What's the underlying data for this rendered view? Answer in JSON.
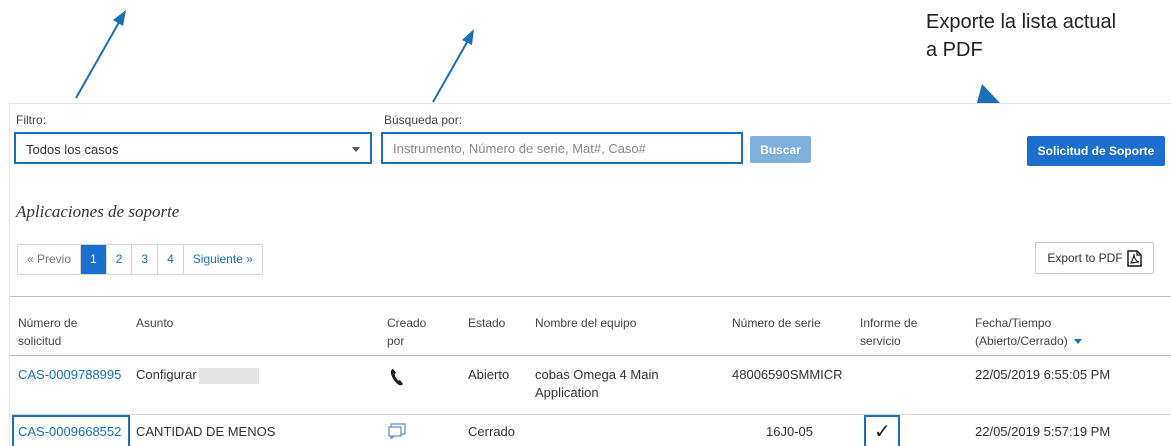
{
  "callout": {
    "line1": "Exporte la lista actual",
    "line2": "a PDF"
  },
  "filter": {
    "label": "Filtro:",
    "selected": "Todos los casos"
  },
  "search": {
    "label": "Búsqueda por:",
    "placeholder": "Instrumento, Número de serie, Mat#, Caso#",
    "value": "",
    "button_label": "Buscar"
  },
  "toolbar": {
    "support_button": "Solicitud de Soporte",
    "export_button": "Export to PDF"
  },
  "section": {
    "title": "Aplicaciones de soporte"
  },
  "pagination": {
    "prev": "« Previo",
    "pages": [
      "1",
      "2",
      "3",
      "4"
    ],
    "current": "1",
    "next": "Siguiente »"
  },
  "table": {
    "columns": {
      "case_number": [
        "Número de",
        "solicitud"
      ],
      "subject": "Asunto",
      "created_by": [
        "Creado",
        "por"
      ],
      "status": "Estado",
      "equipment": "Nombre del equipo",
      "serial": "Número de serie",
      "report": [
        "Informe de",
        "servicio"
      ],
      "datetime": [
        "Fecha/Tiempo",
        "(Abierto/Cerrado)"
      ]
    },
    "rows": [
      {
        "case_number": "CAS-0009788995",
        "subject": "Configurar",
        "created_by_icon": "phone-icon",
        "status": "Abierto",
        "equipment": [
          "cobas Omega 4 Main",
          "Application"
        ],
        "serial": "48006590SMMICR",
        "report": "",
        "datetime": "22/05/2019 6:55:05 PM"
      },
      {
        "case_number": "CAS-0009668552",
        "subject": "CANTIDAD DE MENOS",
        "created_by_icon": "chat-icon",
        "status": "Cerrado",
        "equipment": [
          "",
          ""
        ],
        "serial": "16J0-05",
        "report": "✓",
        "datetime": "22/05/2019 5:57:19 PM"
      }
    ]
  },
  "colors": {
    "accent": "#1a6fcc",
    "link": "#1a6fb6",
    "arrow": "#1a6fb6",
    "disabled_button": "#7fb0dc"
  }
}
